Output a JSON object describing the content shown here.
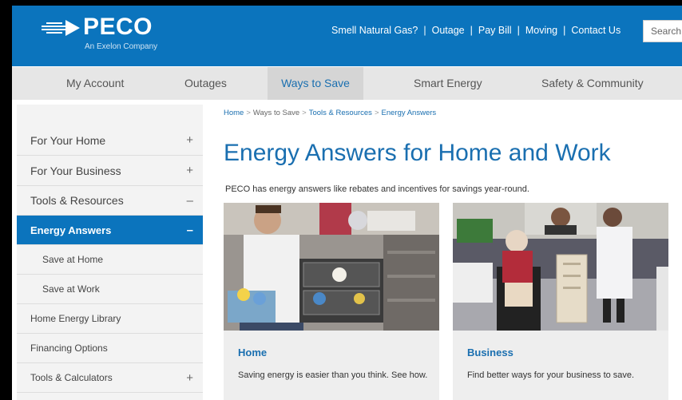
{
  "brand": {
    "name": "PECO",
    "tagline": "An Exelon Company"
  },
  "top_links": [
    "Smell Natural Gas?",
    "Outage",
    "Pay Bill",
    "Moving",
    "Contact Us"
  ],
  "top_link_separator": "|",
  "search": {
    "placeholder": "Search"
  },
  "nav": {
    "items": [
      "My Account",
      "Outages",
      "Ways to Save",
      "Smart Energy",
      "Safety & Community"
    ],
    "active": "Ways to Save"
  },
  "sidebar": {
    "items": [
      {
        "label": "For Your Home",
        "sign": "+"
      },
      {
        "label": "For Your Business",
        "sign": "+"
      },
      {
        "label": "Tools & Resources",
        "sign": "–"
      },
      {
        "label": "Energy Answers",
        "sign": "–"
      },
      {
        "label": "Save at Home",
        "sign": ""
      },
      {
        "label": "Save at Work",
        "sign": ""
      },
      {
        "label": "Home Energy Library",
        "sign": ""
      },
      {
        "label": "Financing Options",
        "sign": ""
      },
      {
        "label": "Tools & Calculators",
        "sign": "+"
      }
    ]
  },
  "breadcrumb": {
    "items": [
      "Home",
      "Ways to Save",
      "Tools & Resources",
      "Energy Answers"
    ],
    "separator": ">"
  },
  "page": {
    "title": "Energy Answers for Home and Work",
    "intro": "PECO has energy answers like rebates and incentives for savings year-round."
  },
  "cards": [
    {
      "title": "Home",
      "text": "Saving energy is easier than you think. See how."
    },
    {
      "title": "Business",
      "text": "Find better ways for your business to save."
    }
  ],
  "colors": {
    "brand_blue": "#0b74bd",
    "link_blue": "#1a6fb0",
    "nav_bg": "#e6e6e6"
  }
}
